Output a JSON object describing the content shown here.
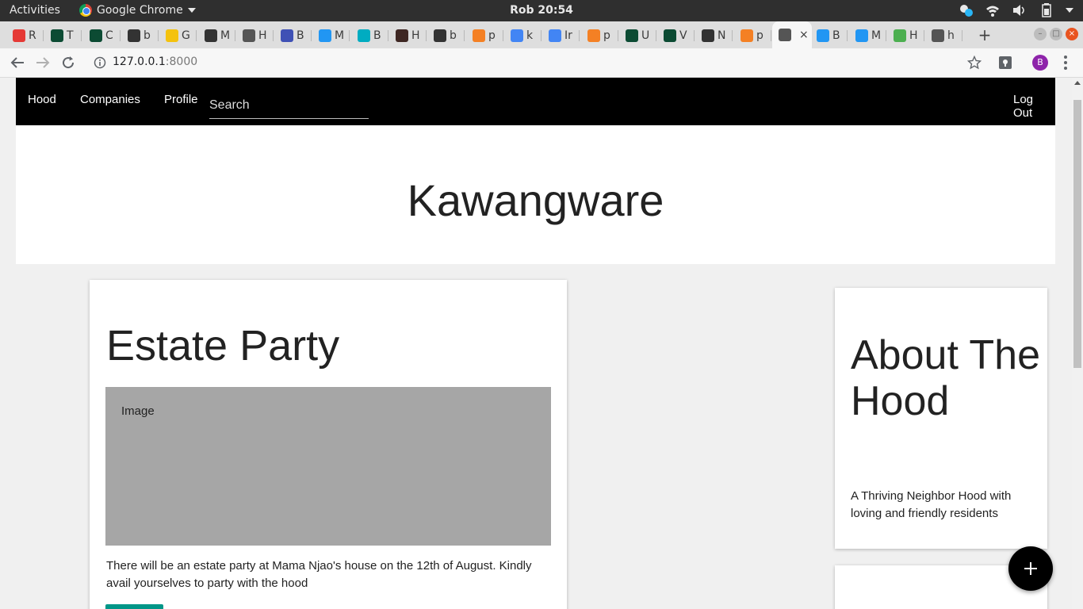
{
  "gnome": {
    "activities": "Activities",
    "app_name": "Google Chrome",
    "clock": "Rob 20:54"
  },
  "tabs": [
    {
      "letter": "R",
      "color": "#e53935"
    },
    {
      "letter": "T",
      "color": "#0c4b33"
    },
    {
      "letter": "C",
      "color": "#0c4b33"
    },
    {
      "letter": "b",
      "color": "#333333"
    },
    {
      "letter": "G",
      "color": "#f4c20d"
    },
    {
      "letter": "M",
      "color": "#333333"
    },
    {
      "letter": "H",
      "color": "#555555"
    },
    {
      "letter": "B",
      "color": "#3f51b5"
    },
    {
      "letter": "M",
      "color": "#2196f3"
    },
    {
      "letter": "B",
      "color": "#00acc1"
    },
    {
      "letter": "H",
      "color": "#3e2723"
    },
    {
      "letter": "b",
      "color": "#333333"
    },
    {
      "letter": "p",
      "color": "#f48024"
    },
    {
      "letter": "k",
      "color": "#4285f4"
    },
    {
      "letter": "Ir",
      "color": "#4285f4"
    },
    {
      "letter": "p",
      "color": "#f48024"
    },
    {
      "letter": "U",
      "color": "#0c4b33"
    },
    {
      "letter": "V",
      "color": "#0c4b33"
    },
    {
      "letter": "N",
      "color": "#333333"
    },
    {
      "letter": "p",
      "color": "#f48024"
    },
    {
      "letter": "",
      "color": "#555555",
      "active": true
    },
    {
      "letter": "B",
      "color": "#2196f3"
    },
    {
      "letter": "M",
      "color": "#2196f3"
    },
    {
      "letter": "H",
      "color": "#4caf50"
    },
    {
      "letter": "h",
      "color": "#555555"
    }
  ],
  "browser": {
    "url_host": "127.0.0.1",
    "url_port": ":8000",
    "avatar_letter": "B"
  },
  "site": {
    "nav": {
      "hood": "Hood",
      "companies": "Companies",
      "profile": "Profile",
      "search_placeholder": "Search",
      "logout": "Log Out"
    },
    "hood_name": "Kawangware",
    "post": {
      "title": "Estate Party",
      "image_label": "Image",
      "body": "There will be an estate party at Mama Njao's house on the 12th of August. Kindly avail yourselves to party with the hood"
    },
    "about": {
      "title": "About The Hood",
      "text": "A Thriving Neighbor Hood with loving and friendly residents"
    }
  },
  "colors": {
    "nav_bg": "#000000",
    "accent_button": "#009688",
    "fab": "#000000",
    "image_placeholder": "#a6a6a6"
  }
}
